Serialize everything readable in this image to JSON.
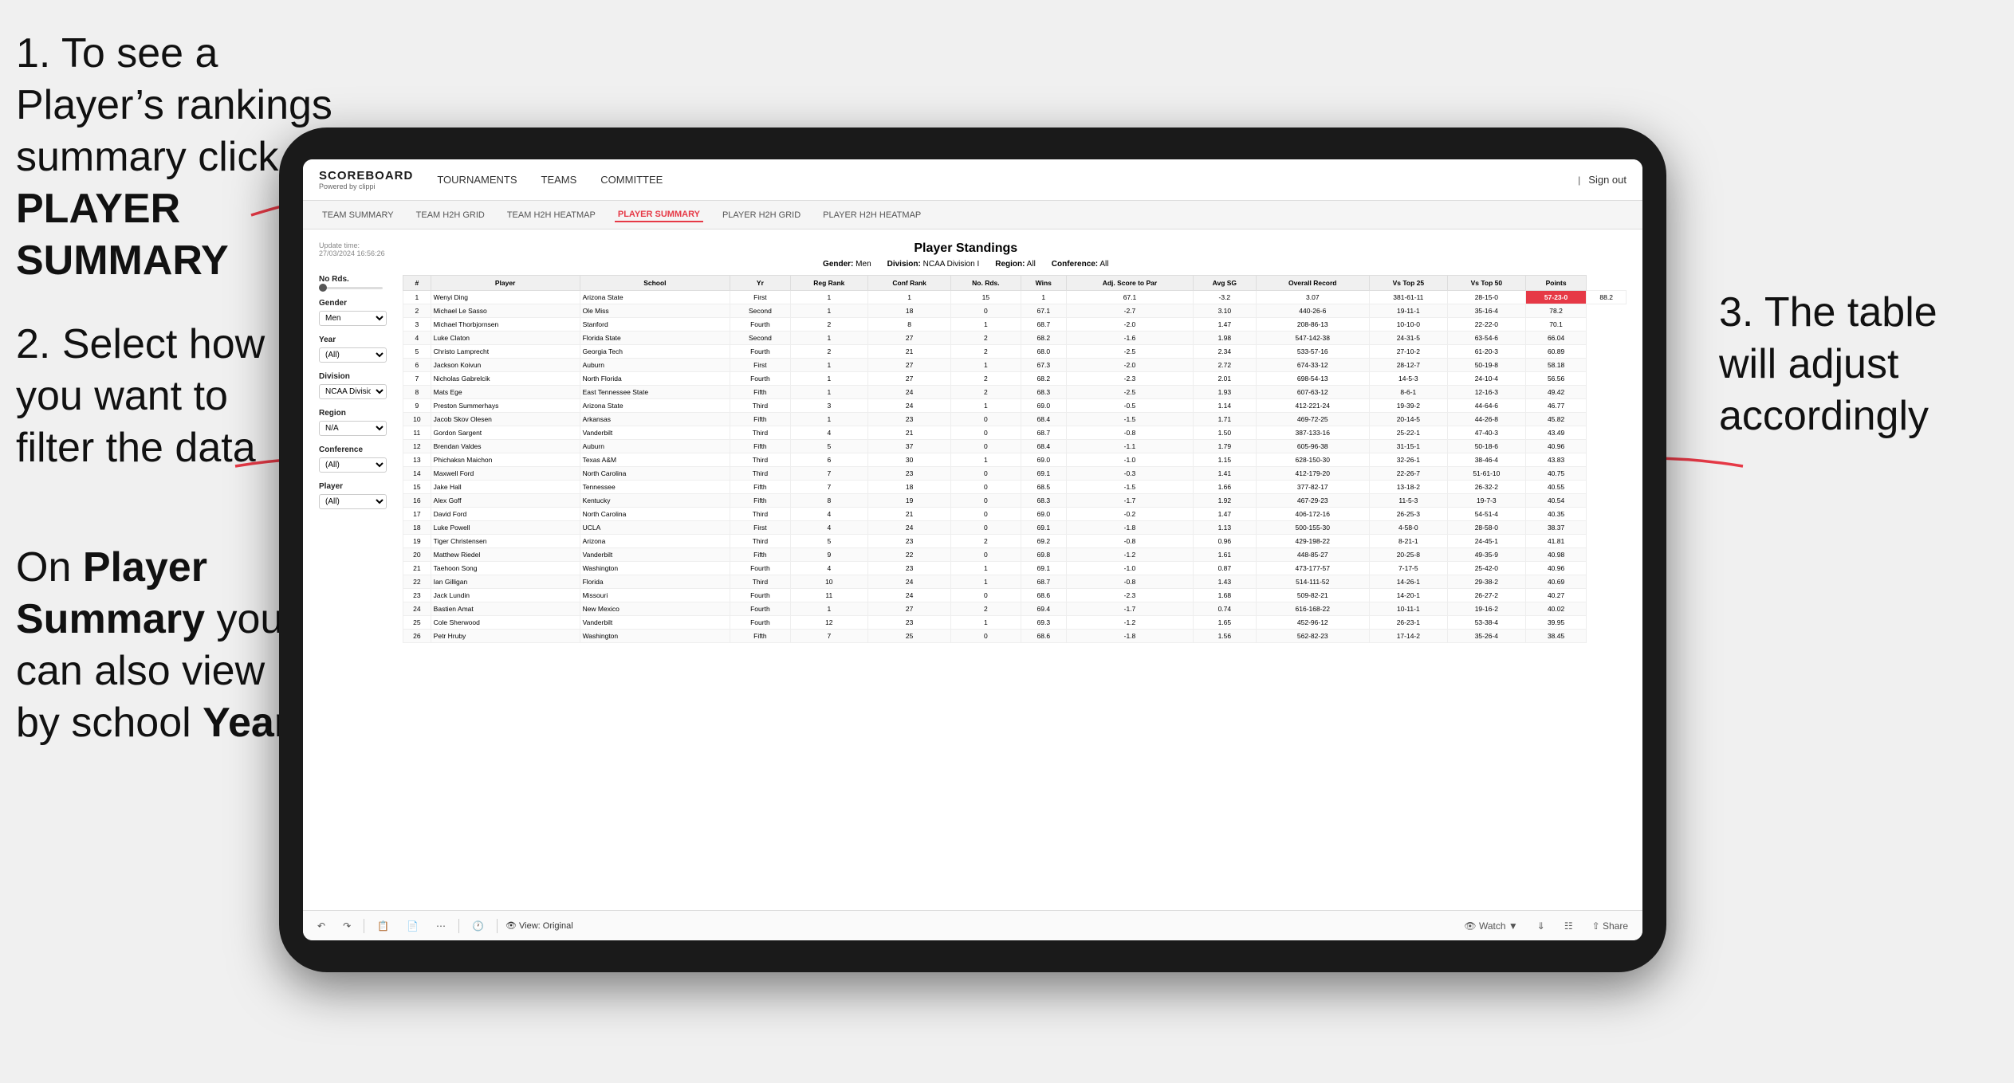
{
  "instructions": {
    "step1": "1. To see a Player’s rankings summary click ",
    "step1_bold": "PLAYER SUMMARY",
    "step2_title": "2. Select how you want to filter the data",
    "step3": "3. The table will adjust accordingly",
    "bottom_title": "On ",
    "bottom_bold1": "Player Summary",
    "bottom_text": " you can also view by school ",
    "bottom_bold2": "Year"
  },
  "app": {
    "logo_main": "SCOREBOARD",
    "logo_sub": "Powered by clippi",
    "sign_out": "Sign out",
    "nav": [
      {
        "label": "TOURNAMENTS",
        "active": false
      },
      {
        "label": "TEAMS",
        "active": false
      },
      {
        "label": "COMMITTEE",
        "active": false
      }
    ],
    "sub_nav": [
      {
        "label": "TEAM SUMMARY",
        "active": false
      },
      {
        "label": "TEAM H2H GRID",
        "active": false
      },
      {
        "label": "TEAM H2H HEATMAP",
        "active": false
      },
      {
        "label": "PLAYER SUMMARY",
        "active": true
      },
      {
        "label": "PLAYER H2H GRID",
        "active": false
      },
      {
        "label": "PLAYER H2H HEATMAP",
        "active": false
      }
    ]
  },
  "page": {
    "update_time": "Update time:",
    "update_date": "27/03/2024 16:56:26",
    "title": "Player Standings",
    "gender_label": "Gender:",
    "gender_value": "Men",
    "division_label": "Division:",
    "division_value": "NCAA Division I",
    "region_label": "Region:",
    "region_value": "All",
    "conference_label": "Conference:",
    "conference_value": "All"
  },
  "filters": {
    "no_rids_label": "No Rds.",
    "gender_label": "Gender",
    "gender_value": "Men",
    "year_label": "Year",
    "year_value": "(All)",
    "division_label": "Division",
    "division_value": "NCAA Division I",
    "region_label": "Region",
    "region_value": "N/A",
    "conference_label": "Conference",
    "conference_value": "(All)",
    "player_label": "Player",
    "player_value": "(All)"
  },
  "table": {
    "headers": [
      "#",
      "Player",
      "School",
      "Yr",
      "Reg Rank",
      "Conf Rank",
      "No. Rds.",
      "Wins",
      "Adj. Score to Par",
      "Avg SG",
      "Overall Record",
      "Vs Top 25",
      "Vs Top 50",
      "Points"
    ],
    "rows": [
      [
        "1",
        "Wenyi Ding",
        "Arizona State",
        "First",
        "1",
        "1",
        "15",
        "1",
        "67.1",
        "-3.2",
        "3.07",
        "381-61-11",
        "28-15-0",
        "57-23-0",
        "88.2"
      ],
      [
        "2",
        "Michael Le Sasso",
        "Ole Miss",
        "Second",
        "1",
        "18",
        "0",
        "67.1",
        "-2.7",
        "3.10",
        "440-26-6",
        "19-11-1",
        "35-16-4",
        "78.2"
      ],
      [
        "3",
        "Michael Thorbjornsen",
        "Stanford",
        "Fourth",
        "2",
        "8",
        "1",
        "68.7",
        "-2.0",
        "1.47",
        "208-86-13",
        "10-10-0",
        "22-22-0",
        "70.1"
      ],
      [
        "4",
        "Luke Claton",
        "Florida State",
        "Second",
        "1",
        "27",
        "2",
        "68.2",
        "-1.6",
        "1.98",
        "547-142-38",
        "24-31-5",
        "63-54-6",
        "66.04"
      ],
      [
        "5",
        "Christo Lamprecht",
        "Georgia Tech",
        "Fourth",
        "2",
        "21",
        "2",
        "68.0",
        "-2.5",
        "2.34",
        "533-57-16",
        "27-10-2",
        "61-20-3",
        "60.89"
      ],
      [
        "6",
        "Jackson Koivun",
        "Auburn",
        "First",
        "1",
        "27",
        "1",
        "67.3",
        "-2.0",
        "2.72",
        "674-33-12",
        "28-12-7",
        "50-19-8",
        "58.18"
      ],
      [
        "7",
        "Nicholas Gabrelcik",
        "North Florida",
        "Fourth",
        "1",
        "27",
        "2",
        "68.2",
        "-2.3",
        "2.01",
        "698-54-13",
        "14-5-3",
        "24-10-4",
        "56.56"
      ],
      [
        "8",
        "Mats Ege",
        "East Tennessee State",
        "Fifth",
        "1",
        "24",
        "2",
        "68.3",
        "-2.5",
        "1.93",
        "607-63-12",
        "8-6-1",
        "12-16-3",
        "49.42"
      ],
      [
        "9",
        "Preston Summerhays",
        "Arizona State",
        "Third",
        "3",
        "24",
        "1",
        "69.0",
        "-0.5",
        "1.14",
        "412-221-24",
        "19-39-2",
        "44-64-6",
        "46.77"
      ],
      [
        "10",
        "Jacob Skov Olesen",
        "Arkansas",
        "Fifth",
        "1",
        "23",
        "0",
        "68.4",
        "-1.5",
        "1.71",
        "469-72-25",
        "20-14-5",
        "44-26-8",
        "45.82"
      ],
      [
        "11",
        "Gordon Sargent",
        "Vanderbilt",
        "Third",
        "4",
        "21",
        "0",
        "68.7",
        "-0.8",
        "1.50",
        "387-133-16",
        "25-22-1",
        "47-40-3",
        "43.49"
      ],
      [
        "12",
        "Brendan Valdes",
        "Auburn",
        "Fifth",
        "5",
        "37",
        "0",
        "68.4",
        "-1.1",
        "1.79",
        "605-96-38",
        "31-15-1",
        "50-18-6",
        "40.96"
      ],
      [
        "13",
        "Phichaksn Maichon",
        "Texas A&M",
        "Third",
        "6",
        "30",
        "1",
        "69.0",
        "-1.0",
        "1.15",
        "628-150-30",
        "32-26-1",
        "38-46-4",
        "43.83"
      ],
      [
        "14",
        "Maxwell Ford",
        "North Carolina",
        "Third",
        "7",
        "23",
        "0",
        "69.1",
        "-0.3",
        "1.41",
        "412-179-20",
        "22-26-7",
        "51-61-10",
        "40.75"
      ],
      [
        "15",
        "Jake Hall",
        "Tennessee",
        "Fifth",
        "7",
        "18",
        "0",
        "68.5",
        "-1.5",
        "1.66",
        "377-82-17",
        "13-18-2",
        "26-32-2",
        "40.55"
      ],
      [
        "16",
        "Alex Goff",
        "Kentucky",
        "Fifth",
        "8",
        "19",
        "0",
        "68.3",
        "-1.7",
        "1.92",
        "467-29-23",
        "11-5-3",
        "19-7-3",
        "40.54"
      ],
      [
        "17",
        "David Ford",
        "North Carolina",
        "Third",
        "4",
        "21",
        "0",
        "69.0",
        "-0.2",
        "1.47",
        "406-172-16",
        "26-25-3",
        "54-51-4",
        "40.35"
      ],
      [
        "18",
        "Luke Powell",
        "UCLA",
        "First",
        "4",
        "24",
        "0",
        "69.1",
        "-1.8",
        "1.13",
        "500-155-30",
        "4-58-0",
        "28-58-0",
        "38.37"
      ],
      [
        "19",
        "Tiger Christensen",
        "Arizona",
        "Third",
        "5",
        "23",
        "2",
        "69.2",
        "-0.8",
        "0.96",
        "429-198-22",
        "8-21-1",
        "24-45-1",
        "41.81"
      ],
      [
        "20",
        "Matthew Riedel",
        "Vanderbilt",
        "Fifth",
        "9",
        "22",
        "0",
        "69.8",
        "-1.2",
        "1.61",
        "448-85-27",
        "20-25-8",
        "49-35-9",
        "40.98"
      ],
      [
        "21",
        "Taehoon Song",
        "Washington",
        "Fourth",
        "4",
        "23",
        "1",
        "69.1",
        "-1.0",
        "0.87",
        "473-177-57",
        "7-17-5",
        "25-42-0",
        "40.96"
      ],
      [
        "22",
        "Ian Gilligan",
        "Florida",
        "Third",
        "10",
        "24",
        "1",
        "68.7",
        "-0.8",
        "1.43",
        "514-111-52",
        "14-26-1",
        "29-38-2",
        "40.69"
      ],
      [
        "23",
        "Jack Lundin",
        "Missouri",
        "Fourth",
        "11",
        "24",
        "0",
        "68.6",
        "-2.3",
        "1.68",
        "509-82-21",
        "14-20-1",
        "26-27-2",
        "40.27"
      ],
      [
        "24",
        "Bastien Amat",
        "New Mexico",
        "Fourth",
        "1",
        "27",
        "2",
        "69.4",
        "-1.7",
        "0.74",
        "616-168-22",
        "10-11-1",
        "19-16-2",
        "40.02"
      ],
      [
        "25",
        "Cole Sherwood",
        "Vanderbilt",
        "Fourth",
        "12",
        "23",
        "1",
        "69.3",
        "-1.2",
        "1.65",
        "452-96-12",
        "26-23-1",
        "53-38-4",
        "39.95"
      ],
      [
        "26",
        "Petr Hruby",
        "Washington",
        "Fifth",
        "7",
        "25",
        "0",
        "68.6",
        "-1.8",
        "1.56",
        "562-82-23",
        "17-14-2",
        "35-26-4",
        "38.45"
      ]
    ]
  },
  "toolbar": {
    "view_label": "View: Original",
    "watch_label": "Watch",
    "share_label": "Share"
  }
}
